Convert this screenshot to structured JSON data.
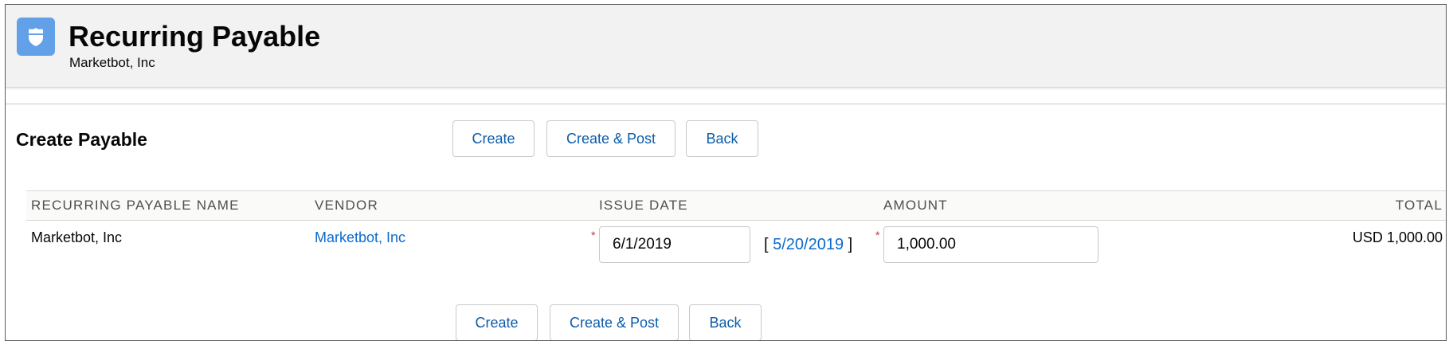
{
  "header": {
    "title": "Recurring Payable",
    "subtitle": "Marketbot, Inc",
    "icon": "shield-icon",
    "icon_color": "#62a0e8"
  },
  "form": {
    "title": "Create Payable",
    "buttons": {
      "create": "Create",
      "create_post": "Create & Post",
      "back": "Back"
    }
  },
  "table": {
    "columns": [
      "Recurring Payable Name",
      "Vendor",
      "Issue Date",
      "Amount",
      "Total"
    ],
    "rows": [
      {
        "name": "Marketbot, Inc",
        "vendor": "Marketbot, Inc",
        "issue_date": "6/1/2019",
        "prior_date": "5/20/2019",
        "amount": "1,000.00",
        "total": "USD 1,000.00"
      }
    ]
  },
  "colors": {
    "link": "#0b6bcb",
    "required": "#c23934",
    "header_bg": "#f3f2f2"
  }
}
